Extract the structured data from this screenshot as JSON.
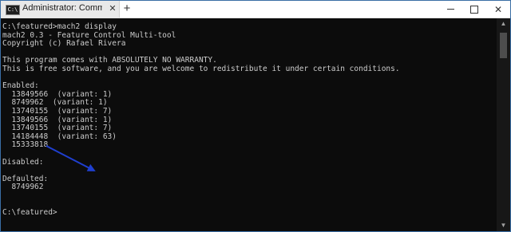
{
  "window": {
    "tab_title": "Administrator: Comma",
    "tab_icon_text": "C:\\",
    "close_glyph": "✕",
    "new_tab_glyph": "+",
    "close_window_glyph": "✕"
  },
  "console": {
    "lines": [
      "C:\\featured>mach2 display",
      "mach2 0.3 - Feature Control Multi-tool",
      "Copyright (c) Rafael Rivera",
      "",
      "This program comes with ABSOLUTELY NO WARRANTY.",
      "This is free software, and you are welcome to redistribute it under certain conditions.",
      "",
      "Enabled:",
      "  13849566  (variant: 1)",
      "  8749962  (variant: 1)",
      "  13740155  (variant: 7)",
      "  13849566  (variant: 1)",
      "  13740155  (variant: 7)",
      "  14184448  (variant: 63)",
      "  15333818",
      "",
      "Disabled:",
      "",
      "Defaulted:",
      "  8749962",
      "",
      "",
      "C:\\featured>"
    ]
  },
  "scrollbar": {
    "up_glyph": "▲",
    "down_glyph": "▼"
  },
  "colors": {
    "console_bg": "#0c0c0c",
    "console_text": "#cccccc",
    "arrow": "#1f3fcf"
  }
}
